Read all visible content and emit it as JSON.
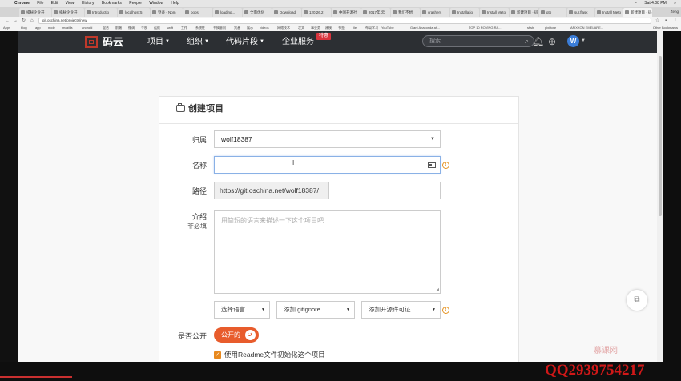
{
  "mac_menu": {
    "app": "Chrome",
    "items": [
      "File",
      "Edit",
      "View",
      "History",
      "Bookmarks",
      "People",
      "Window",
      "Help"
    ],
    "clock": "Sat 4:08 PM"
  },
  "browser": {
    "tabs": [
      "揭秘企业开",
      "揭秘企业开",
      "Introductio",
      "localhost:5",
      "登录 - Nom",
      "oops",
      "loading...",
      "全面优化",
      "Download",
      "120.26.2",
      "中国开源社",
      "2017年 云",
      "我们不想",
      "crashers",
      "Installatio",
      "Install Meto",
      "新建项目 · 码",
      "gtb",
      "sur.flask",
      "Install Meto",
      "新建项目 · 码"
    ],
    "window_user": "Zeng",
    "url": "git.oschina.net/projects/new",
    "bookmarks": [
      "Apps",
      "blog",
      "app",
      "node",
      "mozilla",
      "android",
      "混合",
      "前端",
      "微调",
      "个税",
      "运维",
      "swift",
      "工作",
      "系统性",
      "书摘意向",
      "兆基",
      "展示",
      "videos",
      "网络技术",
      "次文",
      "事业务",
      "建模",
      "书签",
      "file",
      "布局学习",
      "YouTube",
      "Giant Anaconda ah...",
      "TOP 10 ROVING RA...",
      "sfish",
      "pixi tour",
      "AFIXXON EMELARE...",
      "Other Bookmarks"
    ]
  },
  "site": {
    "logo_text": "码云",
    "nav": [
      "项目",
      "组织",
      "代码片段",
      "企业服务"
    ],
    "hot_badge": "特惠",
    "search_placeholder": "搜索...",
    "avatar_letter": "W"
  },
  "form": {
    "title": "创建项目",
    "owner_label": "归属",
    "owner_value": "wolf18387",
    "name_label": "名称",
    "name_value": "",
    "path_label": "路径",
    "path_prefix": "https://git.oschina.net/wolf18387/",
    "path_value": "",
    "desc_label": "介绍",
    "desc_sub": "非必填",
    "desc_placeholder": "用简短的语言来描述一下这个项目吧",
    "language_select": "选择语言",
    "gitignore_select": "添加.gitignore",
    "license_select": "添加开源许可证",
    "public_label": "是否公开",
    "public_toggle": "公开的",
    "readme_checkbox": "使用Readme文件初始化这个项目",
    "readme_checked": true
  },
  "watermark": {
    "logo": "慕课网",
    "qq": "QQ2939754217"
  },
  "colors": {
    "header_bg": "#2c2f33",
    "accent_orange": "#e85c2c",
    "brand_red": "#c0392b"
  }
}
